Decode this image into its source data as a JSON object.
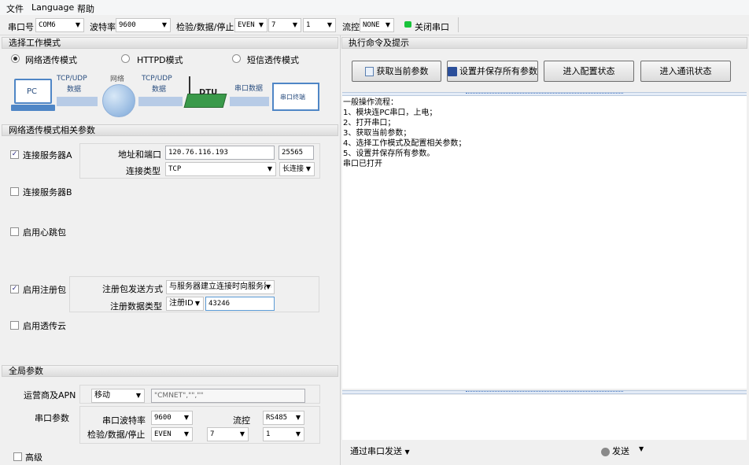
{
  "menu": [
    "文件",
    "Language",
    "帮助"
  ],
  "toolbar": {
    "port_label": "串口号",
    "port_value": "COM6",
    "baud_label": "波特率",
    "baud_value": "9600",
    "check_label": "检验/数据/停止",
    "parity_value": "EVEN",
    "databits_value": "7",
    "stopbits_value": "1",
    "flow_label": "流控",
    "flow_value": "NONE",
    "close_port_label": "关闭串口",
    "status_color": "#18c33a"
  },
  "left": {
    "mode_section": "选择工作模式",
    "modes": [
      {
        "label": "网络透传模式",
        "selected": true
      },
      {
        "label": "HTTPD模式",
        "selected": false
      },
      {
        "label": "短信透传模式",
        "selected": false
      }
    ],
    "diagram": {
      "pc": "PC",
      "tcp_udp_1": "TCP/UDP",
      "data_1": "数据",
      "network": "网络",
      "tcp_udp_2": "TCP/UDP",
      "data_2": "数据",
      "dtu": "DTU",
      "serial_data": "串口数据",
      "serial_terminal": "串口终端"
    },
    "net_section": "网络透传模式相关参数",
    "server_a": {
      "label": "连接服务器A",
      "checked": true,
      "addr_label": "地址和端口",
      "addr_value": "120.76.116.193",
      "port_value": "25565",
      "conn_type_label": "连接类型",
      "conn_type_value": "TCP",
      "conn_mode_value": "长连接"
    },
    "server_b": {
      "label": "连接服务器B",
      "checked": false
    },
    "heartbeat": {
      "label": "启用心跳包",
      "checked": false
    },
    "register": {
      "label": "启用注册包",
      "checked": true,
      "send_mode_label": "注册包发送方式",
      "send_mode_value": "与服务器建立连接时向服务器",
      "data_type_label": "注册数据类型",
      "data_type_value": "注册ID",
      "data_value": "43246"
    },
    "cloud": {
      "label": "启用透传云",
      "checked": false
    },
    "global_section": "全局参数",
    "apn": {
      "label": "运营商及APN",
      "operator_value": "移动",
      "apn_value": "\"CMNET\",\"\",\"\""
    },
    "serial": {
      "label": "串口参数",
      "baud_label": "串口波特率",
      "baud_value": "9600",
      "flow_label": "流控",
      "flow_value": "RS485",
      "check_label": "检验/数据/停止",
      "parity_value": "EVEN",
      "databits_value": "7",
      "stopbits_value": "1"
    },
    "advanced": {
      "label": "高级",
      "checked": false
    }
  },
  "right": {
    "section": "执行命令及提示",
    "buttons": {
      "get_params": "获取当前参数",
      "save_params": "设置并保存所有参数",
      "enter_config": "进入配置状态",
      "enter_comm": "进入通讯状态"
    },
    "log": [
      "一般操作流程：",
      "1、模块连PC串口，上电；",
      "2、打开串口；",
      "3、获取当前参数；",
      "4、选择工作模式及配置相关参数；",
      "5、设置并保存所有参数。",
      "串口已打开"
    ],
    "send_via_label": "通过串口发送",
    "send_label": "发送"
  }
}
